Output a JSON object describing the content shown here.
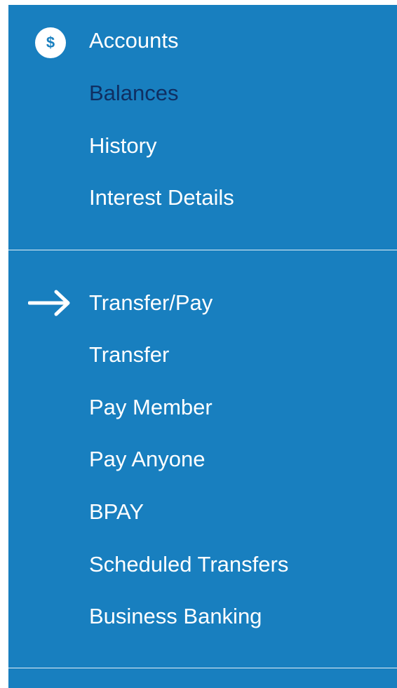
{
  "colors": {
    "panel": "#187fbf",
    "text": "#ffffff",
    "active_text": "#0f2f62"
  },
  "accounts": {
    "header_label": "Accounts",
    "header_icon": "dollar-icon",
    "dollar_glyph": "$",
    "items": [
      {
        "label": "Balances",
        "active": true
      },
      {
        "label": "History",
        "active": false
      },
      {
        "label": "Interest Details",
        "active": false
      }
    ]
  },
  "transfer": {
    "header_label": "Transfer/Pay",
    "header_icon": "arrow-right-icon",
    "items": [
      {
        "label": "Transfer"
      },
      {
        "label": "Pay Member"
      },
      {
        "label": "Pay Anyone"
      },
      {
        "label": "BPAY"
      },
      {
        "label": "Scheduled Transfers"
      },
      {
        "label": "Business Banking"
      }
    ]
  }
}
